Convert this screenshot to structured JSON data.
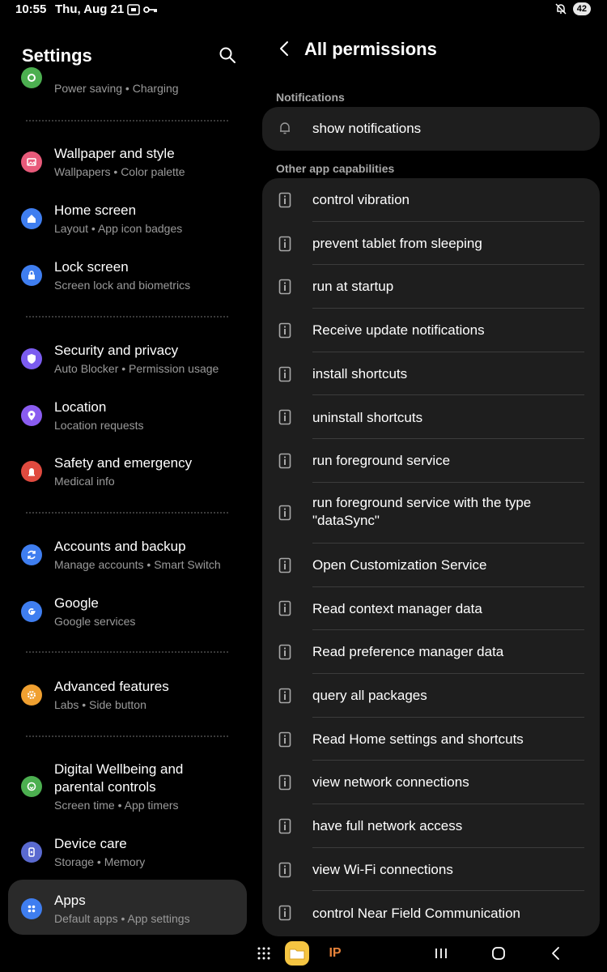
{
  "status_bar": {
    "time": "10:55",
    "date": "Thu, Aug 21",
    "battery": "42",
    "icons": [
      "screenshot-icon",
      "key-icon",
      "mute-icon"
    ]
  },
  "settings": {
    "title": "Settings",
    "items": [
      {
        "title": "",
        "subtitle": "Power saving • Charging",
        "icon": "battery-icon",
        "color": "#4caf50"
      },
      {
        "title": "Wallpaper and style",
        "subtitle": "Wallpapers • Color palette",
        "icon": "image-icon",
        "color": "#e85a7a"
      },
      {
        "title": "Home screen",
        "subtitle": "Layout • App icon badges",
        "icon": "home-icon",
        "color": "#3f7ef0"
      },
      {
        "title": "Lock screen",
        "subtitle": "Screen lock and biometrics",
        "icon": "lock-icon",
        "color": "#3f7ef0"
      },
      {
        "title": "Security and privacy",
        "subtitle": "Auto Blocker • Permission usage",
        "icon": "shield-icon",
        "color": "#7b5cf0"
      },
      {
        "title": "Location",
        "subtitle": "Location requests",
        "icon": "location-icon",
        "color": "#8a5cf0"
      },
      {
        "title": "Safety and emergency",
        "subtitle": "Medical info",
        "icon": "alert-icon",
        "color": "#e04a3f"
      },
      {
        "title": "Accounts and backup",
        "subtitle": "Manage accounts • Smart Switch",
        "icon": "sync-icon",
        "color": "#3f7ef0"
      },
      {
        "title": "Google",
        "subtitle": "Google services",
        "icon": "google-icon",
        "color": "#3f7ef0"
      },
      {
        "title": "Advanced features",
        "subtitle": "Labs • Side button",
        "icon": "star-gear-icon",
        "color": "#f0a030"
      },
      {
        "title": "Digital Wellbeing and parental controls",
        "subtitle": "Screen time • App timers",
        "icon": "wellbeing-icon",
        "color": "#4caf50"
      },
      {
        "title": "Device care",
        "subtitle": "Storage • Memory",
        "icon": "device-care-icon",
        "color": "#5a6ad0"
      },
      {
        "title": "Apps",
        "subtitle": "Default apps • App settings",
        "icon": "apps-icon",
        "color": "#3f7ef0"
      }
    ]
  },
  "permissions": {
    "title": "All permissions",
    "section_notifications": "Notifications",
    "notification_item": "show notifications",
    "section_other": "Other app capabilities",
    "items": [
      "control vibration",
      "prevent tablet from sleeping",
      "run at startup",
      "Receive update notifications",
      "install shortcuts",
      "uninstall shortcuts",
      "run foreground service",
      "run foreground service with the type \"dataSync\"",
      "Open Customization Service",
      "Read context manager data",
      "Read preference manager data",
      "query all packages",
      "Read Home settings and shortcuts",
      "view network connections",
      "have full network access",
      "view Wi-Fi connections",
      "control Near Field Communication"
    ]
  },
  "navbar": {
    "ip_label": "IP",
    "colors": {
      "ip": "#e8833a",
      "folder": "#f5c542"
    }
  }
}
